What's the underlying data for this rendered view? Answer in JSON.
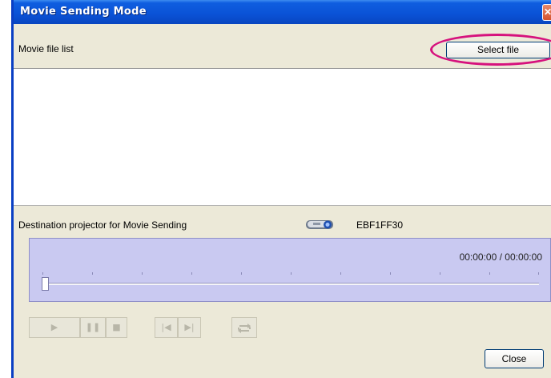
{
  "window": {
    "title": "Movie Sending Mode",
    "close_glyph": "✕"
  },
  "movie_list": {
    "label": "Movie file list",
    "select_button": "Select file"
  },
  "destination": {
    "label": "Destination projector for Movie Sending",
    "projector_name": "EBF1FF30",
    "icon": "projector-icon"
  },
  "player": {
    "time": "00:00:00 / 00:00:00",
    "position": 0,
    "controls": {
      "play_icon": "▶",
      "pause_icon": "❚❚",
      "stop_icon": "■",
      "previous_icon": "|◀",
      "next_icon": "▶|",
      "repeat_icon": "repeat-icon"
    }
  },
  "footer": {
    "close_button": "Close"
  },
  "colors": {
    "titlebar": "#0a52d6",
    "player_background": "#c9c9f1",
    "highlight": "#d6127d"
  }
}
